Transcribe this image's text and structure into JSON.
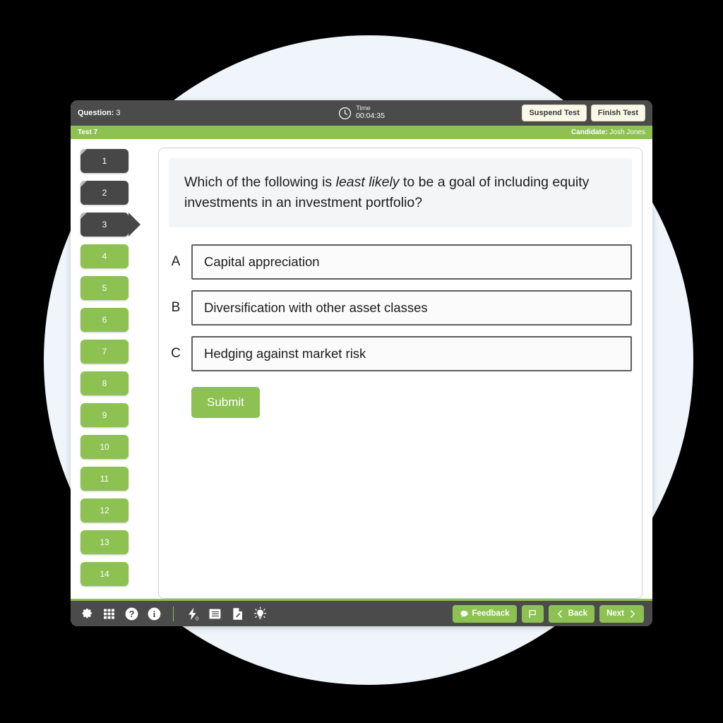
{
  "header": {
    "question_label": "Question:",
    "question_number": "3",
    "timer_label": "Time",
    "timer_value": "00:04:35",
    "clock_icon": "clock-icon",
    "suspend_label": "Suspend Test",
    "finish_label": "Finish Test"
  },
  "subheader": {
    "test_name": "Test 7",
    "candidate_label": "Candidate:",
    "candidate_name": "Josh Jones"
  },
  "sidebar": {
    "items": [
      {
        "number": "1",
        "state": "answered"
      },
      {
        "number": "2",
        "state": "answered"
      },
      {
        "number": "3",
        "state": "answered",
        "active": true
      },
      {
        "number": "4",
        "state": "pending"
      },
      {
        "number": "5",
        "state": "pending"
      },
      {
        "number": "6",
        "state": "pending"
      },
      {
        "number": "7",
        "state": "pending"
      },
      {
        "number": "8",
        "state": "pending"
      },
      {
        "number": "9",
        "state": "pending"
      },
      {
        "number": "10",
        "state": "pending"
      },
      {
        "number": "11",
        "state": "pending"
      },
      {
        "number": "12",
        "state": "pending"
      },
      {
        "number": "13",
        "state": "pending"
      },
      {
        "number": "14",
        "state": "pending"
      }
    ]
  },
  "question": {
    "stem_part1": "Which of the following is ",
    "stem_emphasis": "least likely",
    "stem_part2": " to be a goal of including equity investments in an investment portfolio?",
    "options": [
      {
        "letter": "A",
        "text": "Capital appreciation"
      },
      {
        "letter": "B",
        "text": "Diversification with other asset classes"
      },
      {
        "letter": "C",
        "text": "Hedging against market risk"
      }
    ],
    "submit_label": "Submit"
  },
  "toolbar": {
    "icons": [
      {
        "name": "gear-icon"
      },
      {
        "name": "grid-icon"
      },
      {
        "name": "help-icon"
      },
      {
        "name": "info-icon"
      },
      {
        "name": "flash-icon",
        "badge": "0"
      },
      {
        "name": "notes-icon"
      },
      {
        "name": "scratchpad-icon"
      },
      {
        "name": "hint-icon"
      }
    ],
    "feedback_label": "Feedback",
    "flag_label": "",
    "back_label": "Back",
    "next_label": "Next"
  },
  "colors": {
    "green": "#8dc152",
    "dark": "#4b4b4b",
    "answered": "#474747",
    "cream": "#fbf8e8",
    "circle": "#eff5fb"
  }
}
